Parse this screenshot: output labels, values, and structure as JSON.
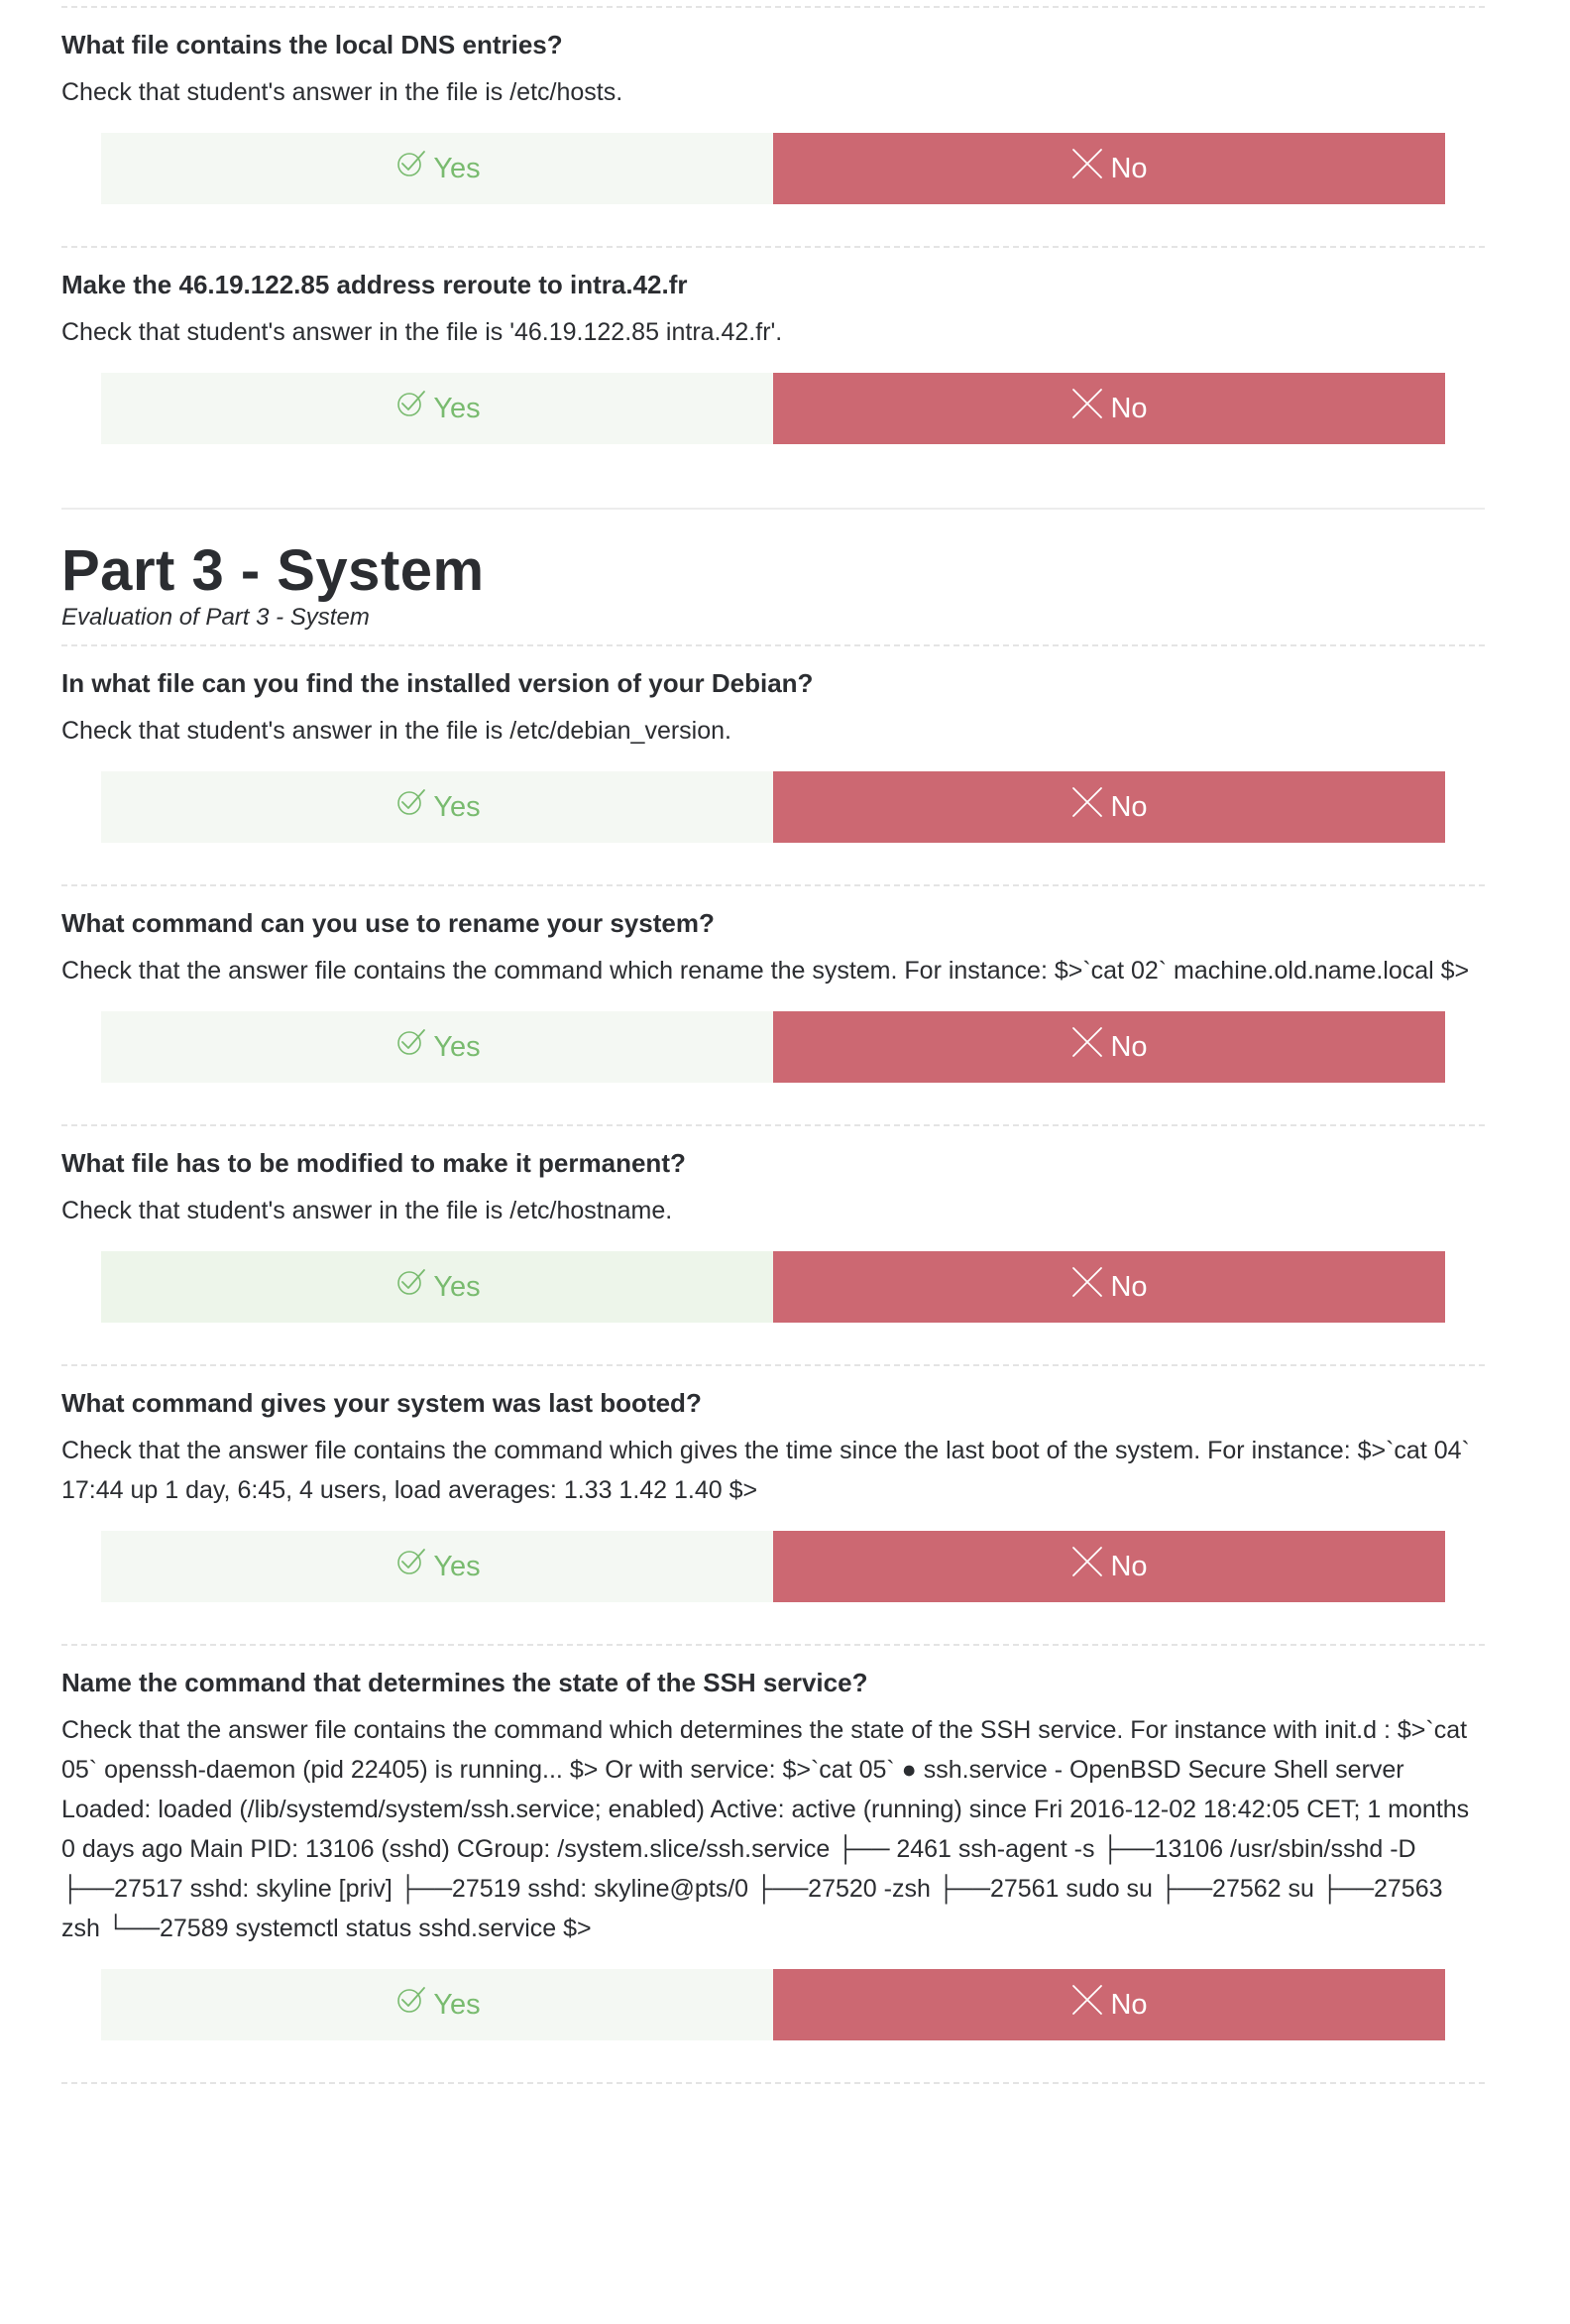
{
  "buttons": {
    "yes_label": "Yes",
    "no_label": "No"
  },
  "colors": {
    "yes_text": "#79bb6f",
    "yes_bg": "#f4f8f3",
    "no_bg": "#cc6872",
    "text": "#2b2d31"
  },
  "questions_before": [
    {
      "title": "What file contains the local DNS entries?",
      "description": "Check that student's answer in the file is /etc/hosts."
    },
    {
      "title": "Make the 46.19.122.85 address reroute to intra.42.fr",
      "description": "Check that student's answer in the file is '46.19.122.85 intra.42.fr'."
    }
  ],
  "part": {
    "title": "Part 3 - System",
    "subtitle": "Evaluation of Part 3 - System"
  },
  "questions": [
    {
      "title": "In what file can you find the installed version of your Debian?",
      "description": "Check that student's answer in the file is /etc/debian_version."
    },
    {
      "title": "What command can you use to rename your system?",
      "description": "Check that the answer file contains the command which rename the system. For instance: $>`cat 02` machine.old.name.local $>"
    },
    {
      "title": "What file has to be modified to make it permanent?",
      "description": "Check that student's answer in the file is /etc/hostname."
    },
    {
      "title": "What command gives your system was last booted?",
      "description": "Check that the answer file contains the command which gives the time since the last boot of the system. For instance: $>`cat 04` 17:44 up 1 day, 6:45, 4 users, load averages: 1.33 1.42 1.40 $>"
    },
    {
      "title": "Name the command that determines the state of the SSH service?",
      "description": "Check that the answer file contains the command which determines the state of the SSH service. For instance with init.d : $>`cat 05` openssh-daemon (pid 22405) is running... $> Or with service: $>`cat 05` ● ssh.service - OpenBSD Secure Shell server Loaded: loaded (/lib/systemd/system/ssh.service; enabled) Active: active (running) since Fri 2016-12-02 18:42:05 CET; 1 months 0 days ago Main PID: 13106 (sshd) CGroup: /system.slice/ssh.service ├── 2461 ssh-agent -s ├──13106 /usr/sbin/sshd -D ├──27517 sshd: skyline [priv] ├──27519 sshd: skyline@pts/0 ├──27520 -zsh ├──27561 sudo su ├──27562 su ├──27563 zsh └──27589 systemctl status sshd.service $>"
    }
  ],
  "icons": {
    "yes": "check-circle-icon",
    "no": "x-cross-icon"
  }
}
